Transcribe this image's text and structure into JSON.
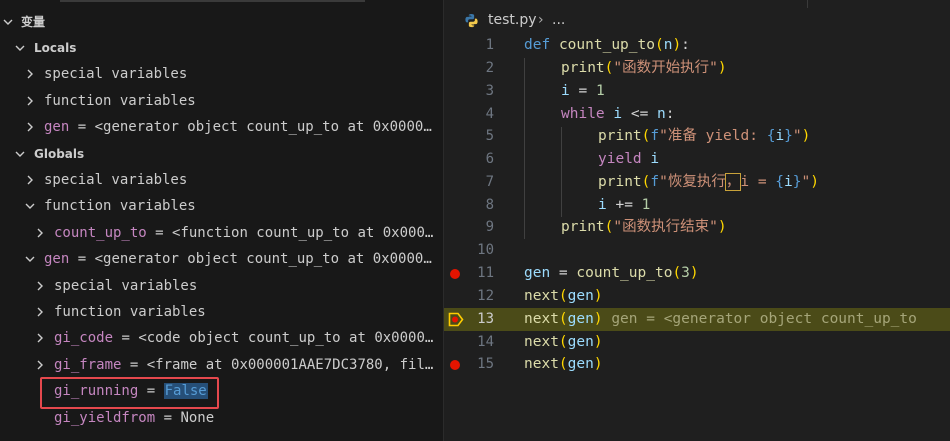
{
  "panel": {
    "title": "变量",
    "locals": {
      "label": "Locals",
      "items": [
        {
          "label": "special variables"
        },
        {
          "label": "function variables"
        },
        {
          "key": "gen",
          "value": "<generator object count_up_to at 0x0000..."
        }
      ]
    },
    "globals": {
      "label": "Globals",
      "items": [
        {
          "label": "special variables"
        },
        {
          "label": "function variables"
        },
        {
          "key": "count_up_to",
          "value": "<function count_up_to at 0x000..."
        },
        {
          "key": "gen",
          "value": "<generator object count_up_to at 0x0000..."
        },
        {
          "label": "special variables"
        },
        {
          "label": "function variables"
        },
        {
          "key": "gi_code",
          "value": "<code object count_up_to at 0x0000..."
        },
        {
          "key": "gi_frame",
          "value": "<frame at 0x000001AAE7DC3780, fil..."
        },
        {
          "key": "gi_running",
          "value": "False"
        },
        {
          "key": "gi_yieldfrom",
          "value": "None"
        }
      ]
    }
  },
  "editor": {
    "filename": "test.py",
    "breadcrumb_sep": "›",
    "breadcrumb_more": "...",
    "line_numbers": [
      "1",
      "2",
      "3",
      "4",
      "5",
      "6",
      "7",
      "8",
      "9",
      "10",
      "11",
      "12",
      "13",
      "14",
      "15"
    ],
    "current_line_inline_value": "gen = <generator object count_up_to",
    "code": {
      "l1": {
        "kw": "def",
        "fn": "count_up_to",
        "lp": "(",
        "param": "n",
        "rp": ")",
        "colon": ":"
      },
      "l2": {
        "fn": "print",
        "lp": "(",
        "str": "\"函数开始执行\"",
        "rp": ")"
      },
      "l3": {
        "var": "i",
        "op": " = ",
        "num": "1"
      },
      "l4": {
        "kw": "while",
        "var": "i",
        "op": " <= ",
        "var2": "n",
        "colon": ":"
      },
      "l5": {
        "fn": "print",
        "lp": "(",
        "fpre": "f",
        "str1": "\"准备 yield: ",
        "lb": "{",
        "var": "i",
        "rb": "}",
        "str2": "\"",
        "rp": ")"
      },
      "l6": {
        "kw": "yield",
        "var": "i"
      },
      "l7": {
        "fn": "print",
        "lp": "(",
        "fpre": "f",
        "str1": "\"恢复执行",
        "comma": "，",
        "str1b": "i = ",
        "lb": "{",
        "var": "i",
        "rb": "}",
        "str2": "\"",
        "rp": ")"
      },
      "l8": {
        "var": "i",
        "op": " += ",
        "num": "1"
      },
      "l9": {
        "fn": "print",
        "lp": "(",
        "str": "\"函数执行结束\"",
        "rp": ")"
      },
      "l11": {
        "var": "gen",
        "op": " = ",
        "fn": "count_up_to",
        "lp": "(",
        "num": "3",
        "rp": ")"
      },
      "l12": {
        "fn": "next",
        "lp": "(",
        "var": "gen",
        "rp": ")"
      },
      "l13": {
        "fn": "next",
        "lp": "(",
        "var": "gen",
        "rp": ")"
      },
      "l14": {
        "fn": "next",
        "lp": "(",
        "var": "gen",
        "rp": ")"
      },
      "l15": {
        "fn": "next",
        "lp": "(",
        "var": "gen",
        "rp": ")"
      }
    }
  },
  "colors": {
    "breakpoint": "#e51400",
    "current_line": "#4b4b18",
    "highlight_box": "#e5484d"
  }
}
